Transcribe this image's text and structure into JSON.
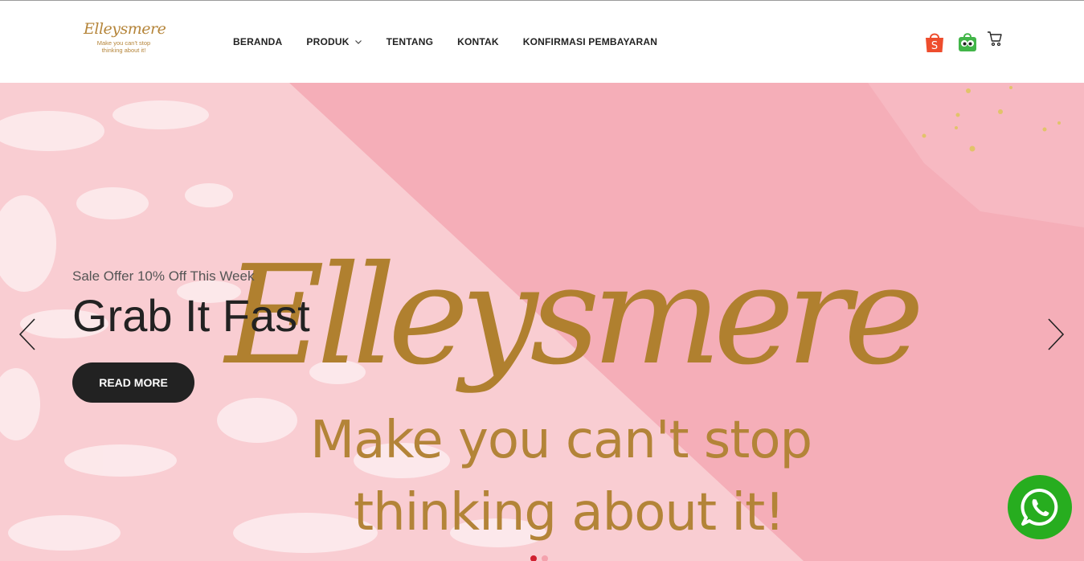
{
  "header": {
    "logo": {
      "name": "Elleysmere",
      "tagline_line1": "Make you can't stop",
      "tagline_line2": "thinking about it!"
    },
    "nav": [
      {
        "label": "BERANDA"
      },
      {
        "label": "PRODUK",
        "has_dropdown": true
      },
      {
        "label": "TENTANG"
      },
      {
        "label": "KONTAK"
      },
      {
        "label": "KONFIRMASI PEMBAYARAN"
      }
    ],
    "icons": [
      "shopee-icon",
      "tokopedia-icon",
      "cart-icon"
    ]
  },
  "hero": {
    "offer": "Sale Offer 10% Off This Week",
    "headline": "Grab It Fast",
    "button": "READ MORE",
    "banner_brand": "Elleysmere",
    "banner_line1": "Make you can't stop",
    "banner_line2": "thinking about it!",
    "slides": 2,
    "active_slide": 1
  },
  "colors": {
    "gold": "#b38438",
    "pink_light": "#f9d2d6",
    "pink": "#f6b0bb",
    "shopee": "#ee4d2d",
    "tokopedia": "#42b549",
    "whatsapp": "#27ad1f",
    "dark": "#222222"
  }
}
